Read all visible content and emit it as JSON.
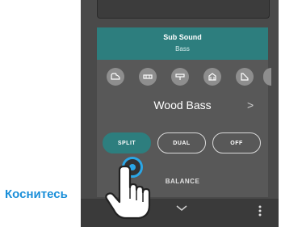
{
  "header": {
    "title": "Sub Sound",
    "subtitle": "Bass"
  },
  "instrument": {
    "name": "Wood Bass",
    "next": ">"
  },
  "modes": {
    "split": "SPLIT",
    "dual": "DUAL",
    "off": "OFF",
    "active": "split"
  },
  "balance_label": "BALANCE",
  "tap_hint": "Коснитесь",
  "icons": [
    "grand-piano-icon",
    "e-piano-icon",
    "organ-icon",
    "church-organ-icon",
    "harpsichord-icon"
  ],
  "colors": {
    "accent": "#2d7e7e",
    "tap": "#2aa6e6",
    "label": "#1b8fd9"
  }
}
